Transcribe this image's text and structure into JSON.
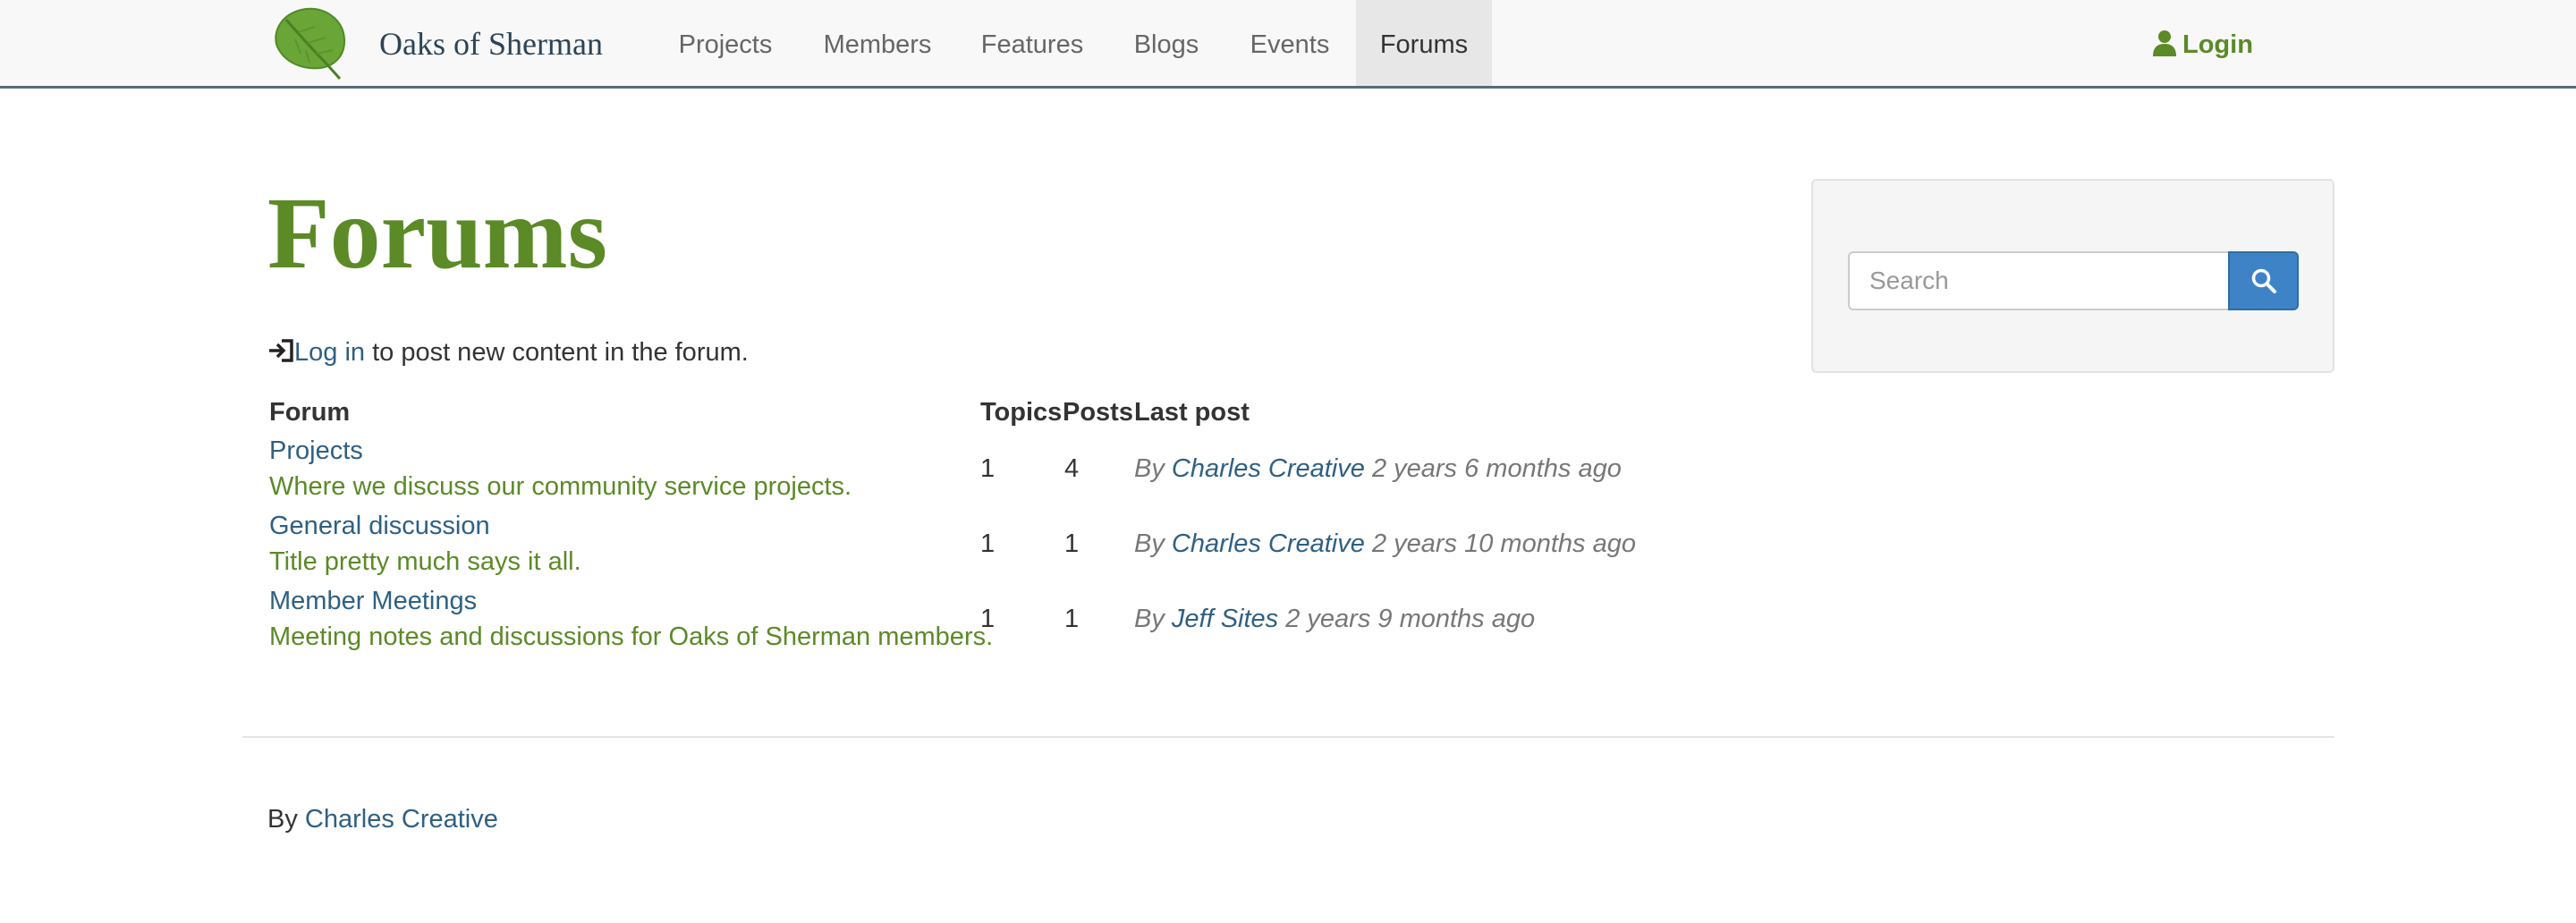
{
  "brand": {
    "name": "Oaks of Sherman",
    "logo_icon": "leaf-logo-icon",
    "accent": "#5b8a27"
  },
  "nav": {
    "items": [
      {
        "label": "Projects",
        "active": false
      },
      {
        "label": "Members",
        "active": false
      },
      {
        "label": "Features",
        "active": false
      },
      {
        "label": "Blogs",
        "active": false
      },
      {
        "label": "Events",
        "active": false
      },
      {
        "label": "Forums",
        "active": true
      }
    ],
    "login": {
      "label": "Login",
      "icon": "user-icon"
    }
  },
  "page": {
    "title": "Forums",
    "login_note": {
      "icon": "sign-in-icon",
      "link": "Log in",
      "text": " to post new content in the forum."
    }
  },
  "table": {
    "headers": {
      "forum": "Forum",
      "topics": "Topics",
      "posts": "Posts",
      "last_post": "Last post"
    },
    "rows": [
      {
        "name": "Projects",
        "description": "Where we discuss our community service projects.",
        "topics": "1",
        "posts": "4",
        "by": "By ",
        "author": "Charles Creative",
        "age": " 2 years 6 months ago"
      },
      {
        "name": "General discussion",
        "description": "Title pretty much says it all.",
        "topics": "1",
        "posts": "1",
        "by": "By ",
        "author": "Charles Creative",
        "age": " 2 years 10 months ago"
      },
      {
        "name": "Member Meetings",
        "description": "Meeting notes and discussions for Oaks of Sherman members.",
        "topics": "1",
        "posts": "1",
        "by": "By ",
        "author": "Jeff Sites",
        "age": " 2 years 9 months ago"
      }
    ]
  },
  "sidebar": {
    "search": {
      "placeholder": "Search",
      "value": "",
      "button_icon": "search-icon",
      "button_color": "#3f83c7"
    }
  },
  "footer": {
    "prefix": "By ",
    "link": "Charles Creative"
  }
}
